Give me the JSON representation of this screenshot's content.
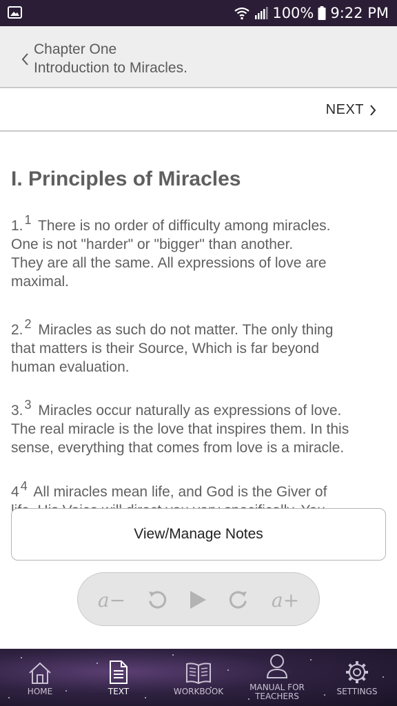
{
  "status_bar": {
    "battery": "100%",
    "time": "9:22 PM",
    "icons": [
      "image-icon",
      "wifi-icon",
      "signal-icon",
      "battery-icon"
    ]
  },
  "header": {
    "chapter": "Chapter One",
    "subtitle": "Introduction to Miracles."
  },
  "nav": {
    "next_label": "NEXT"
  },
  "content": {
    "section_title": "I. Principles of Miracles",
    "paragraphs": [
      {
        "num": "1.",
        "sup": "1",
        "lines": [
          "There is no order of difficulty among miracles.",
          "One is not \"harder\" or \"bigger\" than another.",
          "They are all the same. All expressions of love are",
          "maximal."
        ]
      },
      {
        "num": "2.",
        "sup": "2",
        "lines": [
          "Miracles as such do not matter. The only thing",
          "that matters is their Source, Which is far beyond",
          "human evaluation."
        ]
      },
      {
        "num": "3.",
        "sup": "3",
        "lines": [
          "Miracles occur naturally as expressions of love.",
          "The real miracle is the love that inspires them. In this",
          "sense, everything that comes from love is a miracle."
        ]
      },
      {
        "num": "4",
        "sup": "4",
        "lines": [
          "All miracles mean life, and God is the Giver of",
          "life. His Voice will direct you very specifically. You"
        ]
      }
    ]
  },
  "notes_button": "View/Manage Notes",
  "player": {
    "font_decrease": "a−",
    "font_increase": "a+"
  },
  "bottom_nav": [
    {
      "label": "HOME",
      "icon": "home-icon"
    },
    {
      "label": "TEXT",
      "icon": "text-document-icon",
      "active": true
    },
    {
      "label": "WORKBOOK",
      "icon": "book-icon"
    },
    {
      "label_line1": "MANUAL FOR",
      "label_line2": "TEACHERS",
      "icon": "person-icon"
    },
    {
      "label": "SETTINGS",
      "icon": "gear-icon"
    }
  ]
}
